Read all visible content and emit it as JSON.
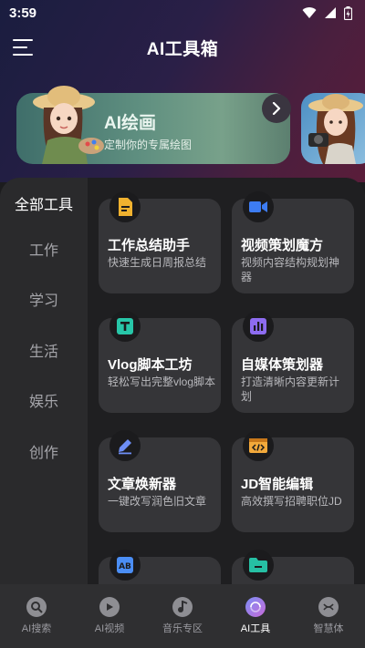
{
  "status": {
    "time": "3:59"
  },
  "header": {
    "title": "AI工具箱"
  },
  "banner": {
    "title": "AI绘画",
    "subtitle": "定制你的专属绘图"
  },
  "categories": [
    {
      "label": "全部工具",
      "active": true
    },
    {
      "label": "工作"
    },
    {
      "label": "学习"
    },
    {
      "label": "生活"
    },
    {
      "label": "娱乐"
    },
    {
      "label": "创作"
    }
  ],
  "cards": [
    {
      "title": "工作总结助手",
      "desc": "快速生成日周报总结",
      "icon": "document-icon",
      "color": "#f0b22f"
    },
    {
      "title": "视频策划魔方",
      "desc": "视频内容结构规划神器",
      "icon": "video-camera-icon",
      "color": "#3d7cf2"
    },
    {
      "title": "Vlog脚本工坊",
      "desc": "轻松写出完整vlog脚本",
      "icon": "text-t-icon",
      "color": "#27c6a8"
    },
    {
      "title": "自媒体策划器",
      "desc": "打造清晰内容更新计划",
      "icon": "bar-chart-icon",
      "color": "#8d6cf0"
    },
    {
      "title": "文章焕新器",
      "desc": "一键改写润色旧文章",
      "icon": "pen-icon",
      "color": "#6d8ef5"
    },
    {
      "title": "JD智能编辑",
      "desc": "高效撰写招聘职位JD",
      "icon": "code-icon",
      "color": "#f2a93b"
    },
    {
      "title": "",
      "desc": "",
      "icon": "ab-icon",
      "color": "#4b8ef5"
    },
    {
      "title": "",
      "desc": "",
      "icon": "folder-icon",
      "color": "#26c0a4"
    }
  ],
  "tabs": [
    {
      "label": "AI搜索",
      "icon": "search-icon"
    },
    {
      "label": "AI视频",
      "icon": "play-icon"
    },
    {
      "label": "音乐专区",
      "icon": "music-note-icon"
    },
    {
      "label": "AI工具",
      "icon": "tool-icon",
      "active": true
    },
    {
      "label": "智慧体",
      "icon": "agent-icon"
    }
  ]
}
